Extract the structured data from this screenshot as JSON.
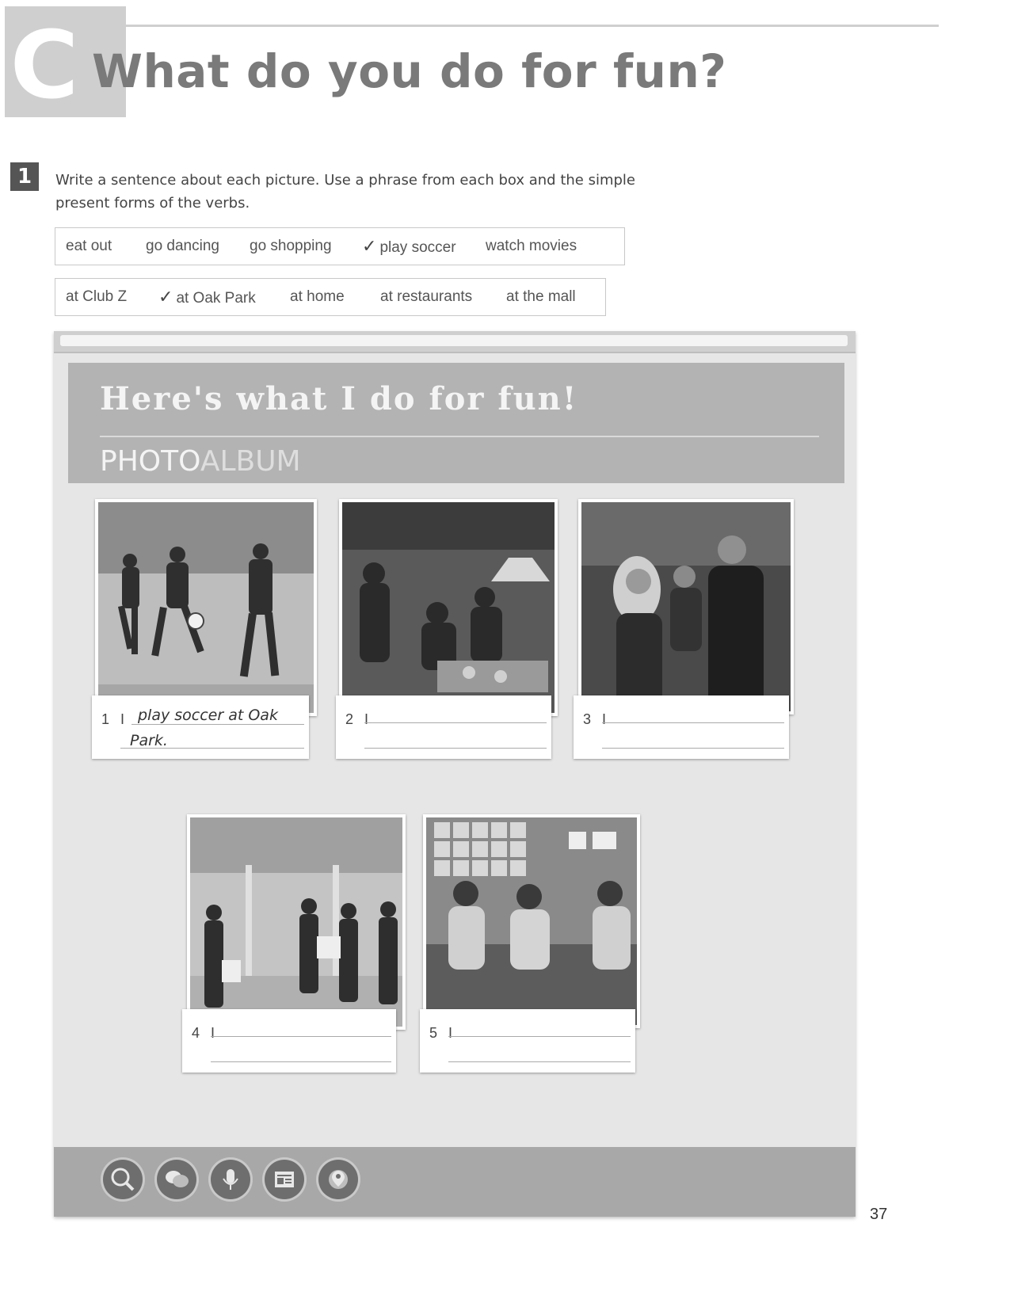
{
  "section": {
    "letter": "C",
    "title": "What do you do for fun?"
  },
  "exercise": {
    "number": "1",
    "instructions": "Write a sentence about each picture. Use a phrase from each box and the simple present forms of the verbs."
  },
  "box1": {
    "items": [
      {
        "text": "eat out",
        "checked": false
      },
      {
        "text": "go dancing",
        "checked": false
      },
      {
        "text": "go shopping",
        "checked": false
      },
      {
        "text": "play soccer",
        "checked": true
      },
      {
        "text": "watch movies",
        "checked": false
      }
    ],
    "tick": "✓"
  },
  "box2": {
    "items": [
      {
        "text": "at Club Z",
        "checked": false
      },
      {
        "text": "at Oak Park",
        "checked": true
      },
      {
        "text": "at home",
        "checked": false
      },
      {
        "text": "at restaurants",
        "checked": false
      },
      {
        "text": "at the mall",
        "checked": false
      }
    ],
    "tick": "✓"
  },
  "album": {
    "title": "Here's what I do for fun!",
    "subtitle_bold": "PHOTO",
    "subtitle_light": "ALBUM",
    "items": [
      {
        "number": "1",
        "pronoun": "I",
        "answer_line1": "play soccer at Oak",
        "answer_line2": "Park."
      },
      {
        "number": "2",
        "pronoun": "I",
        "answer_line1": "",
        "answer_line2": ""
      },
      {
        "number": "3",
        "pronoun": "I",
        "answer_line1": "",
        "answer_line2": ""
      },
      {
        "number": "4",
        "pronoun": "I",
        "answer_line1": "",
        "answer_line2": ""
      },
      {
        "number": "5",
        "pronoun": "I",
        "answer_line1": "",
        "answer_line2": ""
      }
    ],
    "footer_icons": [
      "globe-search-icon",
      "speech-bubbles-icon",
      "microphone-icon",
      "newspaper-icon",
      "globe-pin-icon"
    ]
  },
  "page_number": "37"
}
